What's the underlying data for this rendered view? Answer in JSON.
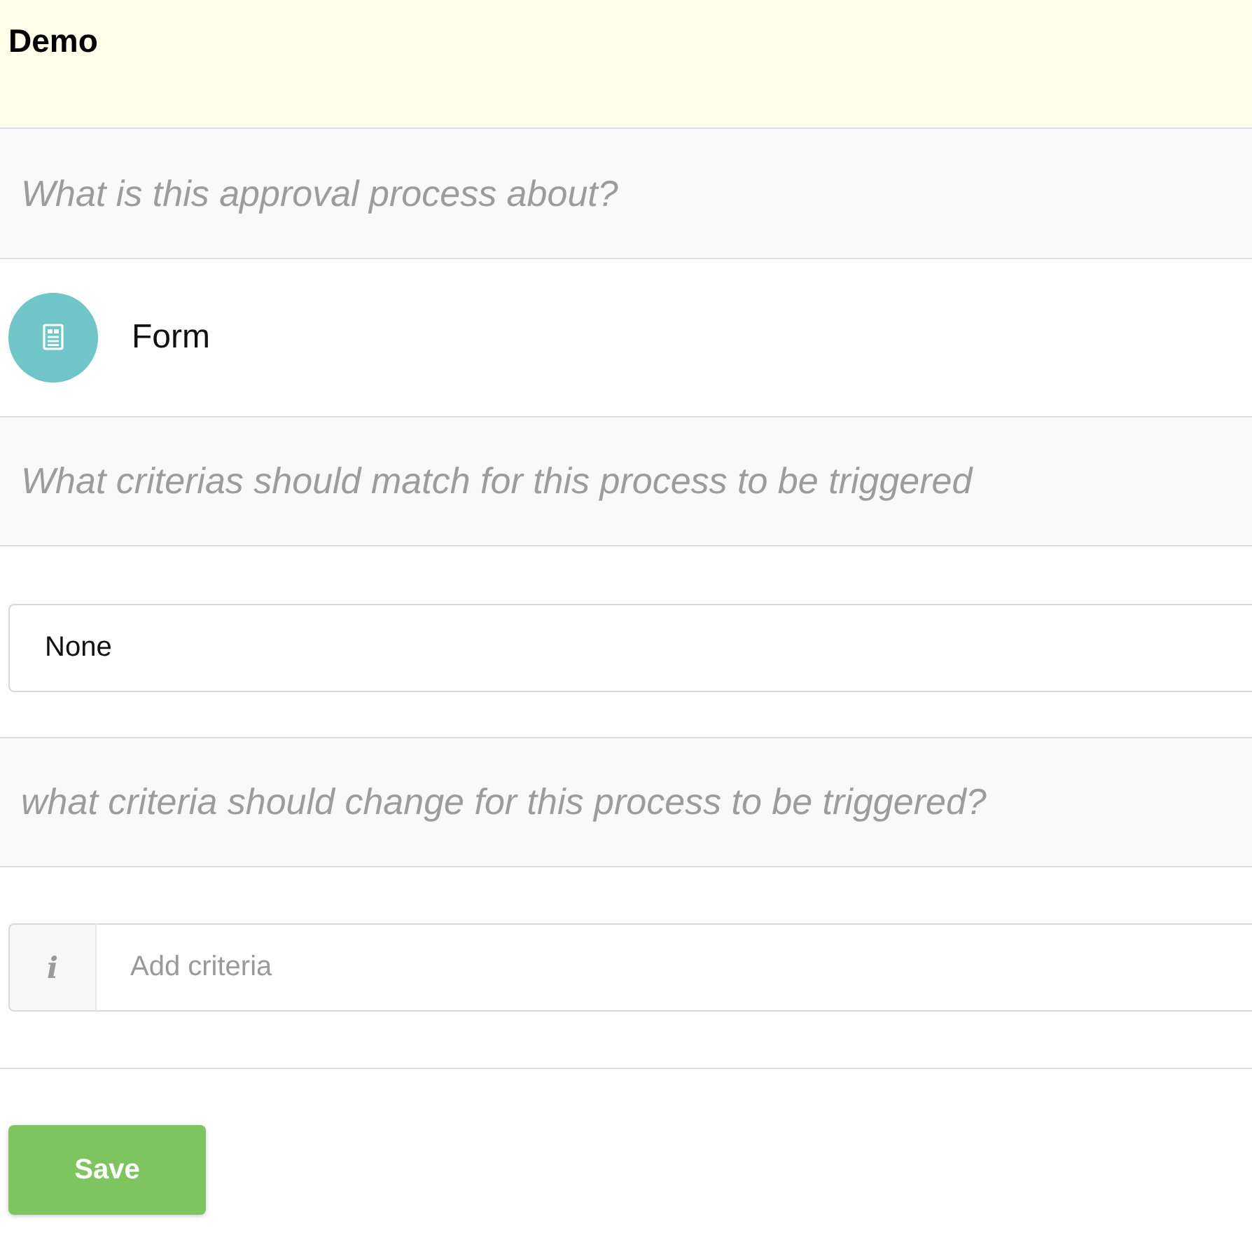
{
  "header": {
    "title": "Demo"
  },
  "description_field": {
    "placeholder": "What is this approval process about?"
  },
  "object": {
    "label": "Form"
  },
  "match_criteria_field": {
    "placeholder": "What criterias should match for this process to be triggered"
  },
  "match_select": {
    "value": "None"
  },
  "change_criteria_field": {
    "placeholder": "what criteria should change for this process to be triggered?"
  },
  "criteria_input": {
    "addon": "i",
    "placeholder": "Add criteria"
  },
  "save_button": {
    "label": "Save"
  }
}
